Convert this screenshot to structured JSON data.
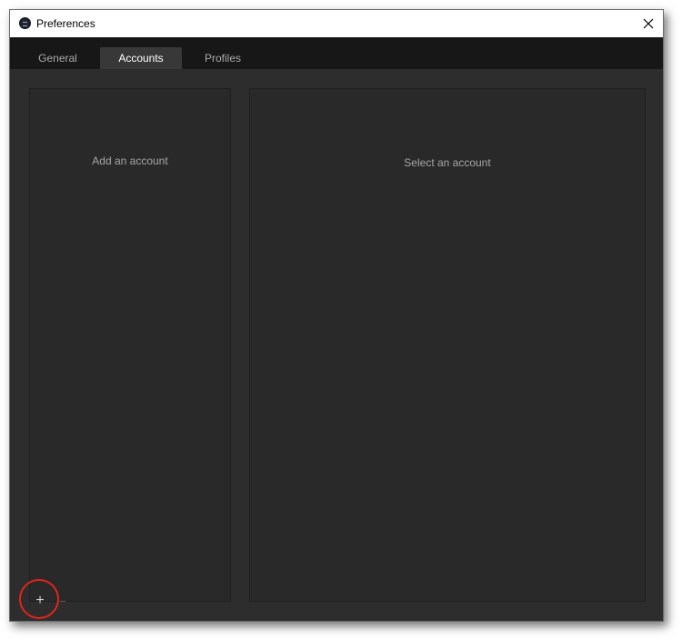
{
  "window": {
    "title": "Preferences",
    "app_icon": "app-icon",
    "close_icon": "close-icon"
  },
  "tabs": [
    {
      "label": "General",
      "active": false
    },
    {
      "label": "Accounts",
      "active": true
    },
    {
      "label": "Profiles",
      "active": false
    }
  ],
  "accounts": {
    "list_placeholder": "Add an account",
    "detail_placeholder": "Select an account",
    "add_label": "+",
    "remove_label": "−"
  },
  "colors": {
    "window_bg": "#2d2d2d",
    "tabbar_bg": "#171717",
    "active_tab_bg": "#383838",
    "panel_bg": "#292929",
    "highlight": "#e3231e"
  }
}
